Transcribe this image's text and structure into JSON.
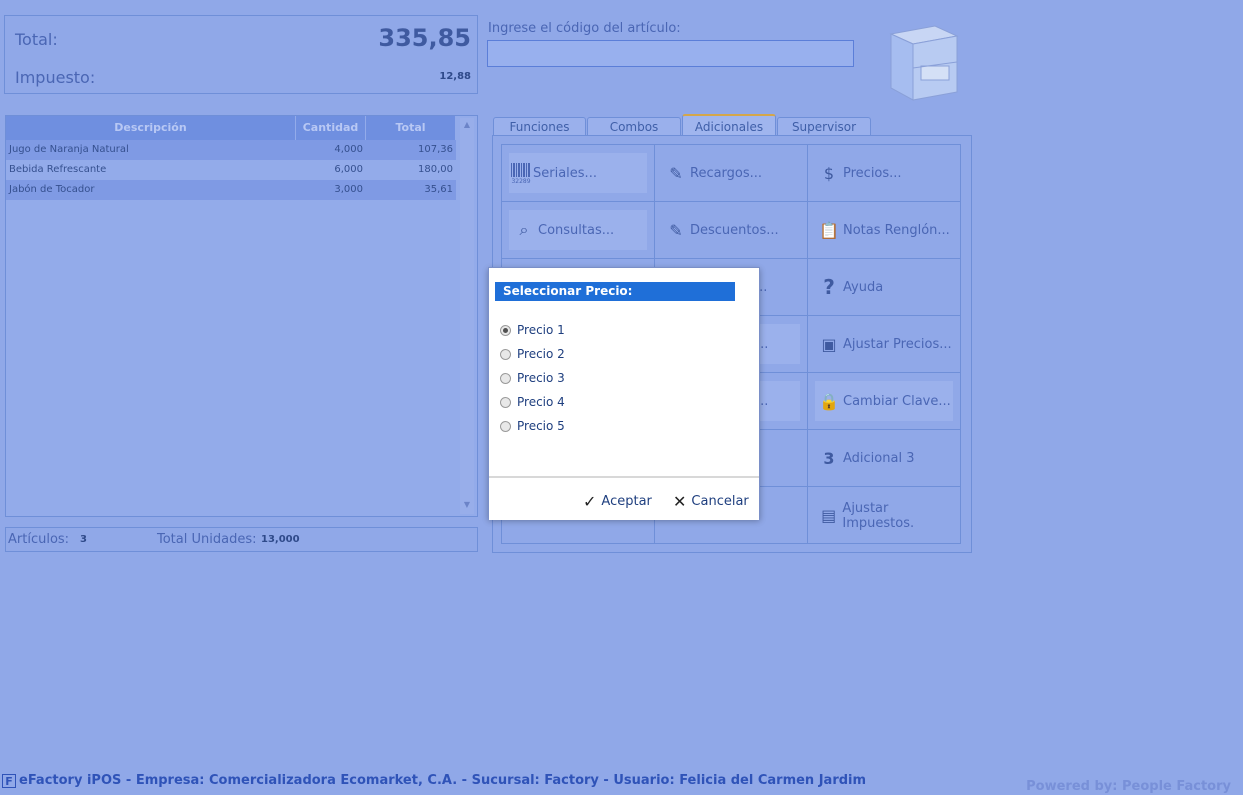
{
  "totals": {
    "total_label": "Total:",
    "total_value": "335,85",
    "tax_label": "Impuesto:",
    "tax_value": "12,88"
  },
  "code": {
    "label": "Ingrese el código del artículo:",
    "value": ""
  },
  "table": {
    "headers": [
      "Descripción",
      "Cantidad",
      "Total"
    ],
    "rows": [
      {
        "desc": "Jugo de Naranja Natural",
        "qty": "4,000",
        "total": "107,36"
      },
      {
        "desc": "Bebida Refrescante",
        "qty": "6,000",
        "total": "180,00"
      },
      {
        "desc": "Jabón de Tocador",
        "qty": "3,000",
        "total": "35,61"
      }
    ]
  },
  "counts": {
    "articles_label": "Artículos:",
    "articles_value": "3",
    "units_label": "Total Unidades:",
    "units_value": "13,000"
  },
  "tabs": [
    {
      "label": "Funciones"
    },
    {
      "label": "Combos"
    },
    {
      "label": "Adicionales",
      "active": true
    },
    {
      "label": "Supervisor"
    }
  ],
  "buttons": {
    "seriales": "Seriales...",
    "recargos": "Recargos...",
    "precios": "Precios...",
    "consultas": "Consultas...",
    "descuentos": "Descuentos...",
    "notas": "Notas Renglón...",
    "ayuda": "Ayuda",
    "ajustar_precios": "Ajustar Precios...",
    "cambiar_clave": "Cambiar Clave...",
    "adicional3": "Adicional 3",
    "ajustar_impuestos": "Ajustar Impuestos.",
    "partial_a": "...",
    "partial_b": "...",
    "partial_c": "..."
  },
  "icons": {
    "barcode_caption": "32289"
  },
  "dialog": {
    "title": "Seleccionar Precio:",
    "options": [
      "Precio 1",
      "Precio 2",
      "Precio 3",
      "Precio 4",
      "Precio 5"
    ],
    "selected": "Precio 1",
    "accept": "Aceptar",
    "cancel": "Cancelar"
  },
  "status": {
    "text": "eFactory iPOS - Empresa: Comercializadora Ecomarket, C.A. - Sucursal: Factory - Usuario: Felicia del Carmen Jardim",
    "logo": "F",
    "powered": "Powered by: People Factory"
  },
  "colors": {
    "background": "#90a8e8",
    "dialog_title": "#1f6fd8",
    "header_row": "#6f8fe0"
  }
}
